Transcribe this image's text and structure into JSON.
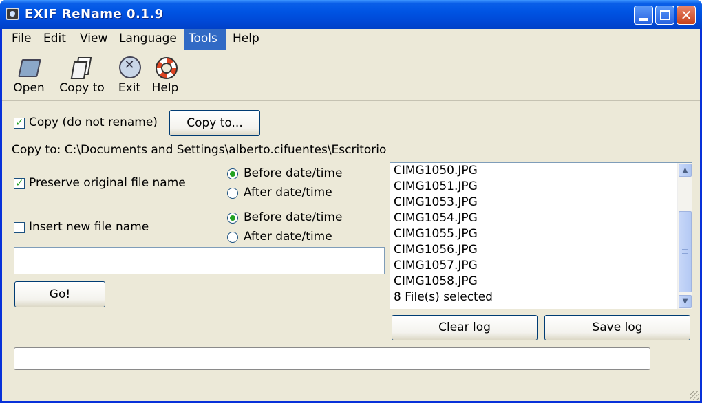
{
  "window": {
    "title": "EXIF ReName 0.1.9"
  },
  "menu": [
    {
      "label": "File"
    },
    {
      "label": "Edit"
    },
    {
      "label": "View"
    },
    {
      "label": "Language"
    },
    {
      "label": "Tools",
      "active": true
    },
    {
      "label": "Help"
    }
  ],
  "toolbar": {
    "open_label": "Open",
    "copy_to_label": "Copy to",
    "exit_label": "Exit",
    "help_label": "Help"
  },
  "form": {
    "copy_checkbox_label": "Copy (do not rename)",
    "copy_checkbox_checked": true,
    "copy_to_button": "Copy to...",
    "copy_to_path": "Copy to: C:\\Documents and Settings\\alberto.cifuentes\\Escritorio",
    "preserve_label": "Preserve original file name",
    "preserve_checked": true,
    "preserve_before": "Before date/time",
    "preserve_after": "After date/time",
    "preserve_selected": "before",
    "insert_label": "Insert new file name",
    "insert_checked": false,
    "insert_before": "Before date/time",
    "insert_after": "After date/time",
    "insert_selected": "before",
    "new_name_value": "",
    "go_button": "Go!"
  },
  "log": {
    "items": [
      "CIMG1050.JPG",
      "CIMG1051.JPG",
      "CIMG1053.JPG",
      "CIMG1054.JPG",
      "CIMG1055.JPG",
      "CIMG1056.JPG",
      "CIMG1057.JPG",
      "CIMG1058.JPG",
      "8 File(s) selected"
    ],
    "clear_button": "Clear log",
    "save_button": "Save log"
  },
  "status": {
    "progress_value": ""
  },
  "colors": {
    "titlebar": "#0054e3",
    "menu_highlight": "#316ac5",
    "check_green": "#21a121"
  }
}
